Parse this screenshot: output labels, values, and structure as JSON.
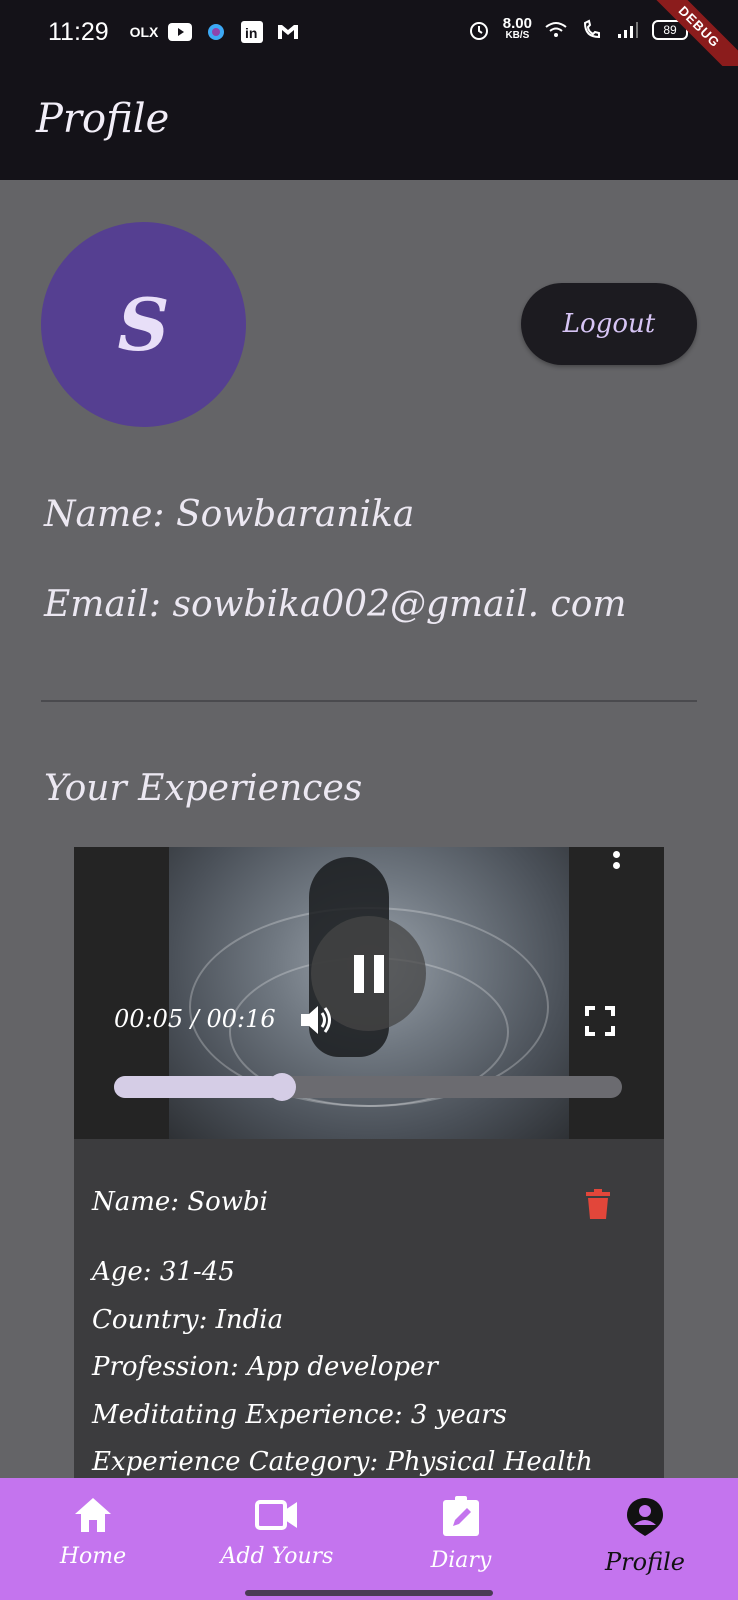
{
  "status_bar": {
    "time": "11:29",
    "left_icons": [
      "olx-icon",
      "youtube-icon",
      "app-icon",
      "linkedin-icon",
      "gmail-icon"
    ],
    "speed_value": "8.00",
    "speed_unit": "KB/S",
    "battery": "89",
    "debug_label": "DEBUG"
  },
  "app_bar": {
    "title": "Profile"
  },
  "profile": {
    "avatar_initial": "S",
    "logout_label": "Logout",
    "name_line": "Name: Sowbaranika",
    "email_line": "Email: sowbika002@gmail. com"
  },
  "experiences": {
    "section_title": "Your Experiences",
    "video": {
      "time_display": "00:05 / 00:16",
      "progress": 0.33
    },
    "details": {
      "name": "Name: Sowbi",
      "age": "Age: 31-45",
      "country": "Country: India",
      "profession": "Profession: App developer",
      "meditating": "Meditating Experience: 3 years",
      "category": "Experience Category: Physical Health"
    }
  },
  "bottom_nav": {
    "items": [
      {
        "label": "Home",
        "icon": "home-icon"
      },
      {
        "label": "Add Yours",
        "icon": "video-camera-icon"
      },
      {
        "label": "Diary",
        "icon": "edit-note-icon"
      },
      {
        "label": "Profile",
        "icon": "account-pin-icon",
        "active": true
      }
    ]
  },
  "colors": {
    "background": "#646467",
    "app_bar": "#141218",
    "avatar": "#553f91",
    "nav": "#c474ee",
    "delete": "#e2463a"
  }
}
